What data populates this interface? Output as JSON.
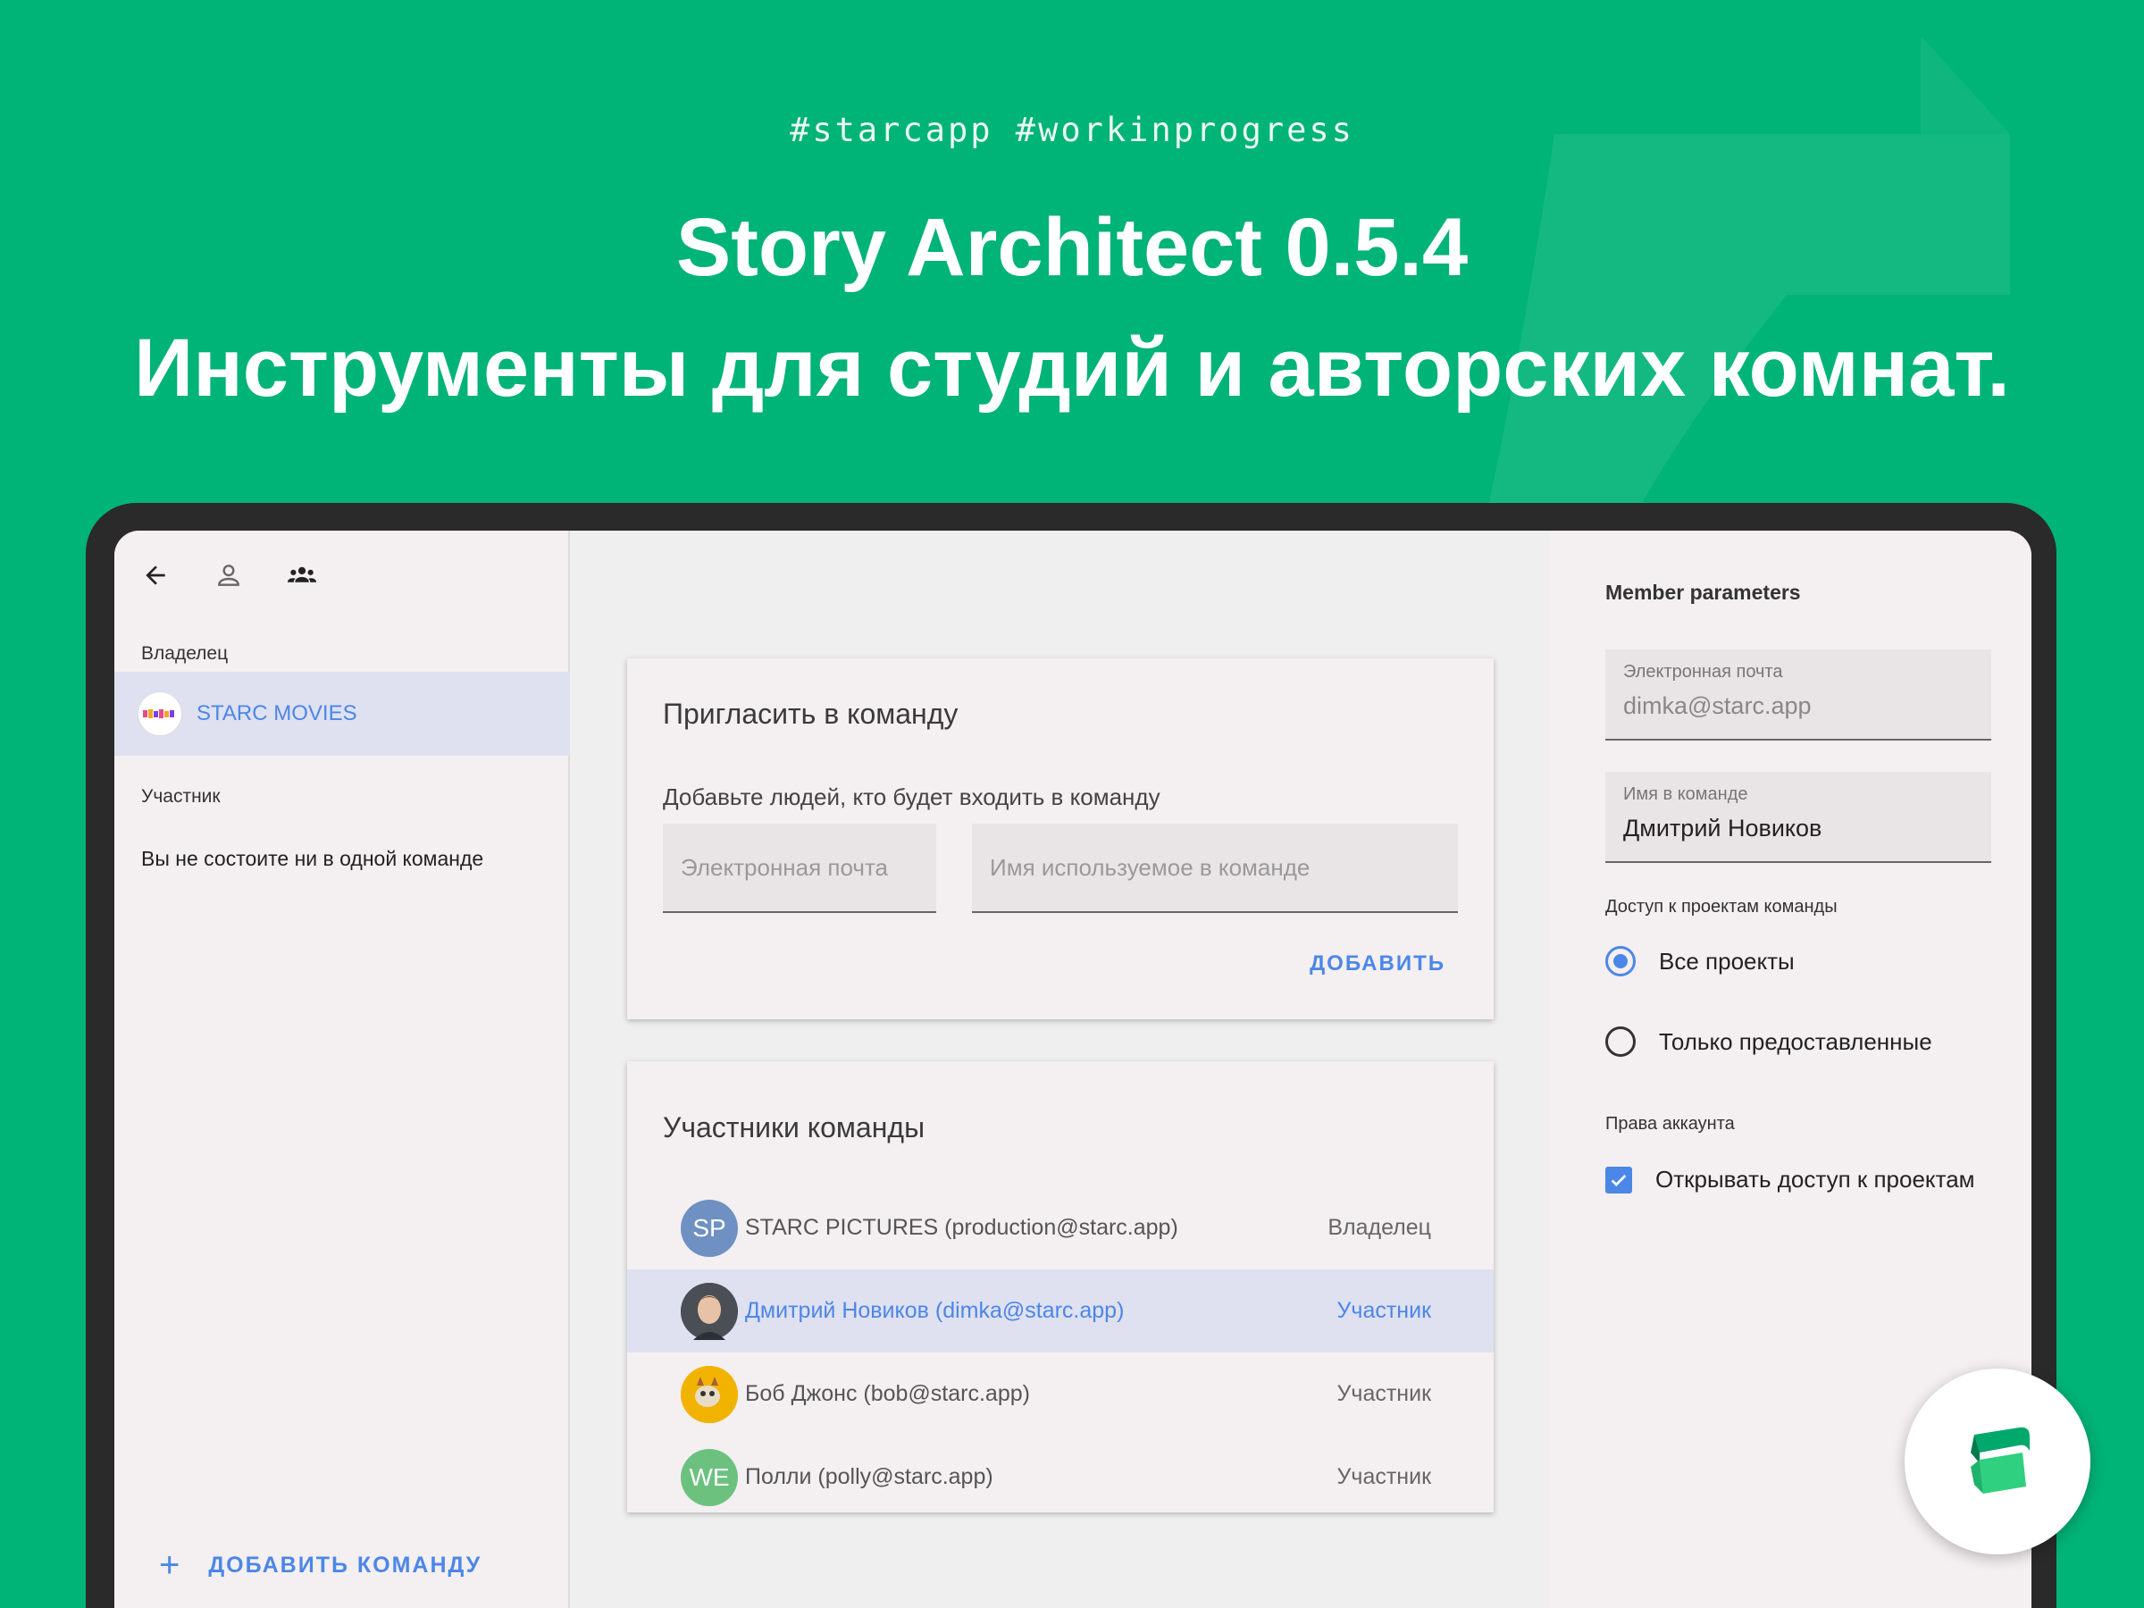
{
  "header": {
    "hashtags": "#starcapp  #workinprogress",
    "title": "Story Architect 0.5.4",
    "subtitle": "Инструменты для студий и авторских комнат."
  },
  "left_panel": {
    "icons": [
      "back-arrow-icon",
      "person-icon",
      "team-icon"
    ],
    "owner_label": "Владелец",
    "owner_team": "STARC MOVIES",
    "member_label": "Участник",
    "no_team_text": "Вы не состоите ни в одной команде",
    "add_team_label": "ДОБАВИТЬ КОМАНДУ"
  },
  "invite": {
    "title": "Пригласить в команду",
    "description": "Добавьте людей, кто будет входить в команду",
    "email_placeholder": "Электронная почта",
    "name_placeholder": "Имя используемое в команде",
    "add_button": "ДОБАВИТЬ"
  },
  "members": {
    "title": "Участники команды",
    "rows": [
      {
        "initials": "SP",
        "name": "STARC PICTURES (production@starc.app)",
        "role": "Владелец",
        "avatar_color": "#6e90c2"
      },
      {
        "initials": "",
        "name": "Дмитрий Новиков (dimka@starc.app)",
        "role": "Участник",
        "avatar_color": "#5c6a78"
      },
      {
        "initials": "",
        "name": "Боб Джонс (bob@starc.app)",
        "role": "Участник",
        "avatar_color": "#f2b300"
      },
      {
        "initials": "WE",
        "name": "Полли (polly@starc.app)",
        "role": "Участник",
        "avatar_color": "#6cc17f"
      }
    ]
  },
  "member_parameters": {
    "title": "Member parameters",
    "email_label": "Электронная почта",
    "email_value": "dimka@starc.app",
    "name_label": "Имя в команде",
    "name_value": "Дмитрий Новиков",
    "access_label": "Доступ к проектам команды",
    "option_all": "Все проекты",
    "option_granted": "Только предоставленные",
    "selected_option": "Все проекты",
    "rights_label": "Права аккаунта",
    "open_access": "Открывать доступ к проектам",
    "open_access_checked": true
  },
  "colors": {
    "background": "#00b377",
    "accent": "#4b87e6",
    "panel": "#f4eff1",
    "selection": "#dfe0f0"
  }
}
